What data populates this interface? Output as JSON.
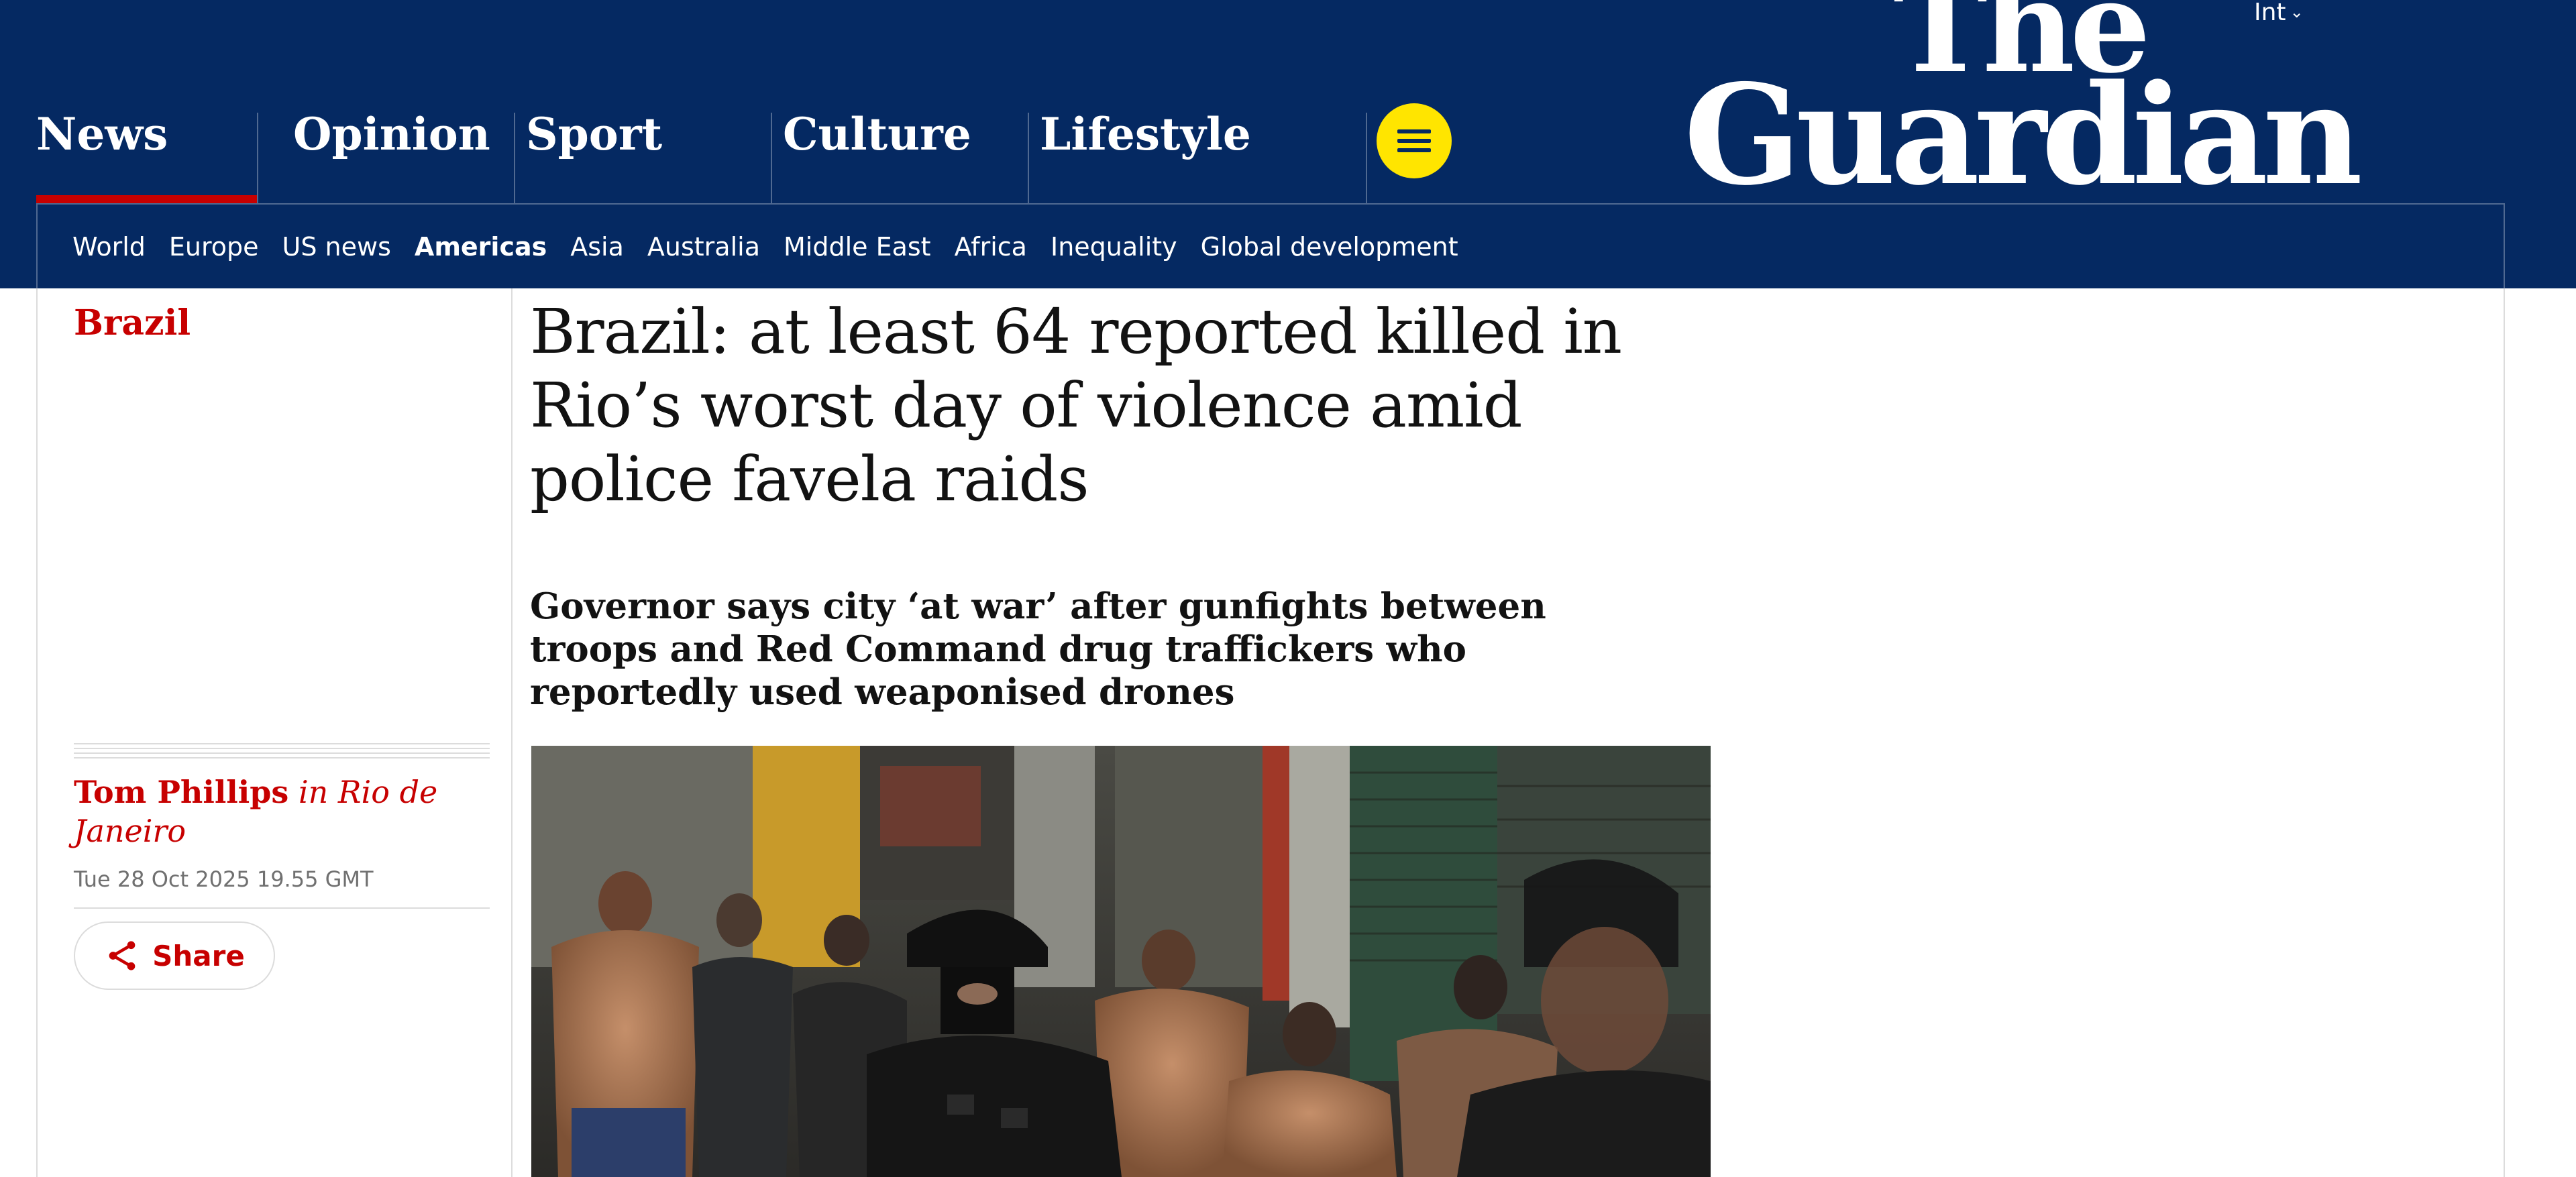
{
  "header": {
    "edition_label": "Int",
    "logo_line1": "The",
    "logo_line2": "Guardian",
    "pillars": [
      {
        "label": "News",
        "active": true
      },
      {
        "label": "Opinion",
        "active": false
      },
      {
        "label": "Sport",
        "active": false
      },
      {
        "label": "Culture",
        "active": false
      },
      {
        "label": "Lifestyle",
        "active": false
      }
    ],
    "menu_icon": "hamburger-icon",
    "subnav": [
      {
        "label": "World",
        "active": false
      },
      {
        "label": "Europe",
        "active": false
      },
      {
        "label": "US news",
        "active": false
      },
      {
        "label": "Americas",
        "active": true
      },
      {
        "label": "Asia",
        "active": false
      },
      {
        "label": "Australia",
        "active": false
      },
      {
        "label": "Middle East",
        "active": false
      },
      {
        "label": "Africa",
        "active": false
      },
      {
        "label": "Inequality",
        "active": false
      },
      {
        "label": "Global development",
        "active": false
      }
    ]
  },
  "article": {
    "section": "Brazil",
    "headline": "Brazil: at least 64 reported killed in Rio’s worst day of violence amid police favela raids",
    "standfirst": "Governor says city ‘at war’ after gunfights between troops and Red Command drug traffickers who reportedly used weaponised drones",
    "author": "Tom Phillips",
    "location": "in Rio de Janeiro",
    "dateline": "Tue 28 Oct 2025 19.55 GMT",
    "share_label": "Share",
    "share_icon": "share-icon"
  },
  "colors": {
    "brand_blue": "#052962",
    "news_red": "#c70000",
    "menu_yellow": "#ffe500"
  }
}
